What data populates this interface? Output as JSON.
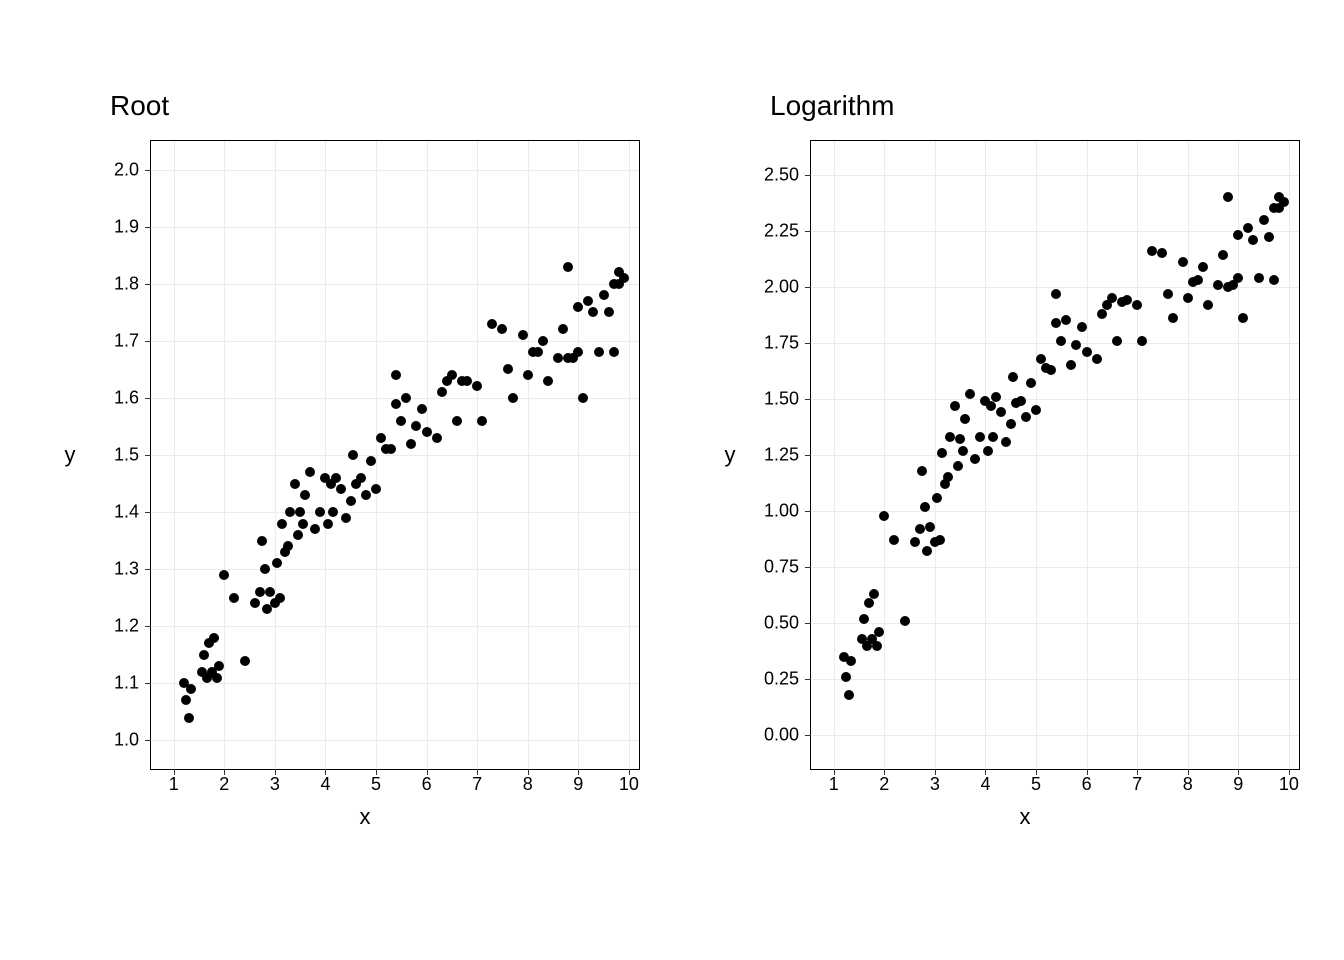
{
  "chart_data": [
    {
      "type": "scatter",
      "title": "Root",
      "xlabel": "x",
      "ylabel": "y",
      "xlim": [
        0.55,
        10.2
      ],
      "ylim": [
        0.95,
        2.05
      ],
      "xticks": [
        1,
        2,
        3,
        4,
        5,
        6,
        7,
        8,
        9,
        10
      ],
      "yticks": [
        1.0,
        1.1,
        1.2,
        1.3,
        1.4,
        1.5,
        1.6,
        1.7,
        1.8,
        1.9,
        2.0
      ],
      "x": [
        1.2,
        1.25,
        1.3,
        1.35,
        1.55,
        1.6,
        1.65,
        1.7,
        1.75,
        1.8,
        1.85,
        1.9,
        2.0,
        2.2,
        2.4,
        2.6,
        2.7,
        2.75,
        2.8,
        2.85,
        2.9,
        3.0,
        3.05,
        3.1,
        3.15,
        3.2,
        3.25,
        3.3,
        3.4,
        3.45,
        3.5,
        3.55,
        3.6,
        3.7,
        3.8,
        3.9,
        4.0,
        4.05,
        4.1,
        4.15,
        4.2,
        4.3,
        4.4,
        4.5,
        4.55,
        4.6,
        4.7,
        4.8,
        4.9,
        5.0,
        5.1,
        5.2,
        5.3,
        5.4,
        5.4,
        5.5,
        5.6,
        5.7,
        5.8,
        5.9,
        6.0,
        6.2,
        6.3,
        6.4,
        6.5,
        6.6,
        6.7,
        6.8,
        7.0,
        7.1,
        7.3,
        7.5,
        7.6,
        7.7,
        7.9,
        8.0,
        8.1,
        8.2,
        8.3,
        8.4,
        8.6,
        8.7,
        8.8,
        8.8,
        8.9,
        9.0,
        9.0,
        9.1,
        9.2,
        9.3,
        9.4,
        9.5,
        9.6,
        9.7,
        9.7,
        9.8,
        9.8,
        9.9
      ],
      "y": [
        1.1,
        1.07,
        1.04,
        1.09,
        1.12,
        1.15,
        1.11,
        1.17,
        1.12,
        1.18,
        1.11,
        1.13,
        1.29,
        1.25,
        1.14,
        1.24,
        1.26,
        1.35,
        1.3,
        1.23,
        1.26,
        1.24,
        1.31,
        1.25,
        1.38,
        1.33,
        1.34,
        1.4,
        1.45,
        1.36,
        1.4,
        1.38,
        1.43,
        1.47,
        1.37,
        1.4,
        1.46,
        1.38,
        1.45,
        1.4,
        1.46,
        1.44,
        1.39,
        1.42,
        1.5,
        1.45,
        1.46,
        1.43,
        1.49,
        1.44,
        1.53,
        1.51,
        1.51,
        1.59,
        1.64,
        1.56,
        1.6,
        1.52,
        1.55,
        1.58,
        1.54,
        1.53,
        1.61,
        1.63,
        1.64,
        1.56,
        1.63,
        1.63,
        1.62,
        1.56,
        1.73,
        1.72,
        1.65,
        1.6,
        1.71,
        1.64,
        1.68,
        1.68,
        1.7,
        1.63,
        1.67,
        1.72,
        1.67,
        1.83,
        1.67,
        1.68,
        1.76,
        1.6,
        1.77,
        1.75,
        1.68,
        1.78,
        1.75,
        1.8,
        1.68,
        1.8,
        1.82,
        1.81
      ]
    },
    {
      "type": "scatter",
      "title": "Logarithm",
      "xlabel": "x",
      "ylabel": "y",
      "xlim": [
        0.55,
        10.2
      ],
      "ylim": [
        -0.15,
        2.65
      ],
      "xticks": [
        1,
        2,
        3,
        4,
        5,
        6,
        7,
        8,
        9,
        10
      ],
      "yticks": [
        0.0,
        0.25,
        0.5,
        0.75,
        1.0,
        1.25,
        1.5,
        1.75,
        2.0,
        2.25,
        2.5
      ],
      "x": [
        1.2,
        1.25,
        1.3,
        1.35,
        1.55,
        1.6,
        1.65,
        1.7,
        1.75,
        1.8,
        1.85,
        1.9,
        2.0,
        2.2,
        2.4,
        2.6,
        2.7,
        2.75,
        2.8,
        2.85,
        2.9,
        3.0,
        3.05,
        3.1,
        3.15,
        3.2,
        3.25,
        3.3,
        3.4,
        3.45,
        3.5,
        3.55,
        3.6,
        3.7,
        3.8,
        3.9,
        4.0,
        4.05,
        4.1,
        4.15,
        4.2,
        4.3,
        4.4,
        4.5,
        4.55,
        4.6,
        4.7,
        4.8,
        4.9,
        5.0,
        5.1,
        5.2,
        5.3,
        5.4,
        5.4,
        5.5,
        5.6,
        5.7,
        5.8,
        5.9,
        6.0,
        6.2,
        6.3,
        6.4,
        6.5,
        6.6,
        6.7,
        6.8,
        7.0,
        7.1,
        7.3,
        7.5,
        7.6,
        7.7,
        7.9,
        8.0,
        8.1,
        8.2,
        8.3,
        8.4,
        8.6,
        8.7,
        8.8,
        8.8,
        8.9,
        9.0,
        9.0,
        9.1,
        9.2,
        9.3,
        9.4,
        9.5,
        9.6,
        9.7,
        9.7,
        9.8,
        9.8,
        9.9
      ],
      "y": [
        0.35,
        0.26,
        0.18,
        0.33,
        0.43,
        0.52,
        0.4,
        0.59,
        0.43,
        0.63,
        0.4,
        0.46,
        0.98,
        0.87,
        0.51,
        0.86,
        0.92,
        1.18,
        1.02,
        0.82,
        0.93,
        0.86,
        1.06,
        0.87,
        1.26,
        1.12,
        1.15,
        1.33,
        1.47,
        1.2,
        1.32,
        1.27,
        1.41,
        1.52,
        1.23,
        1.33,
        1.49,
        1.27,
        1.47,
        1.33,
        1.51,
        1.44,
        1.31,
        1.39,
        1.6,
        1.48,
        1.49,
        1.42,
        1.57,
        1.45,
        1.68,
        1.64,
        1.63,
        1.84,
        1.97,
        1.76,
        1.85,
        1.65,
        1.74,
        1.82,
        1.71,
        1.68,
        1.88,
        1.92,
        1.95,
        1.76,
        1.93,
        1.94,
        1.92,
        1.76,
        2.16,
        2.15,
        1.97,
        1.86,
        2.11,
        1.95,
        2.02,
        2.03,
        2.09,
        1.92,
        2.01,
        2.14,
        2.0,
        2.4,
        2.01,
        2.04,
        2.23,
        1.86,
        2.26,
        2.21,
        2.04,
        2.3,
        2.22,
        2.35,
        2.03,
        2.35,
        2.4,
        2.38
      ]
    }
  ]
}
